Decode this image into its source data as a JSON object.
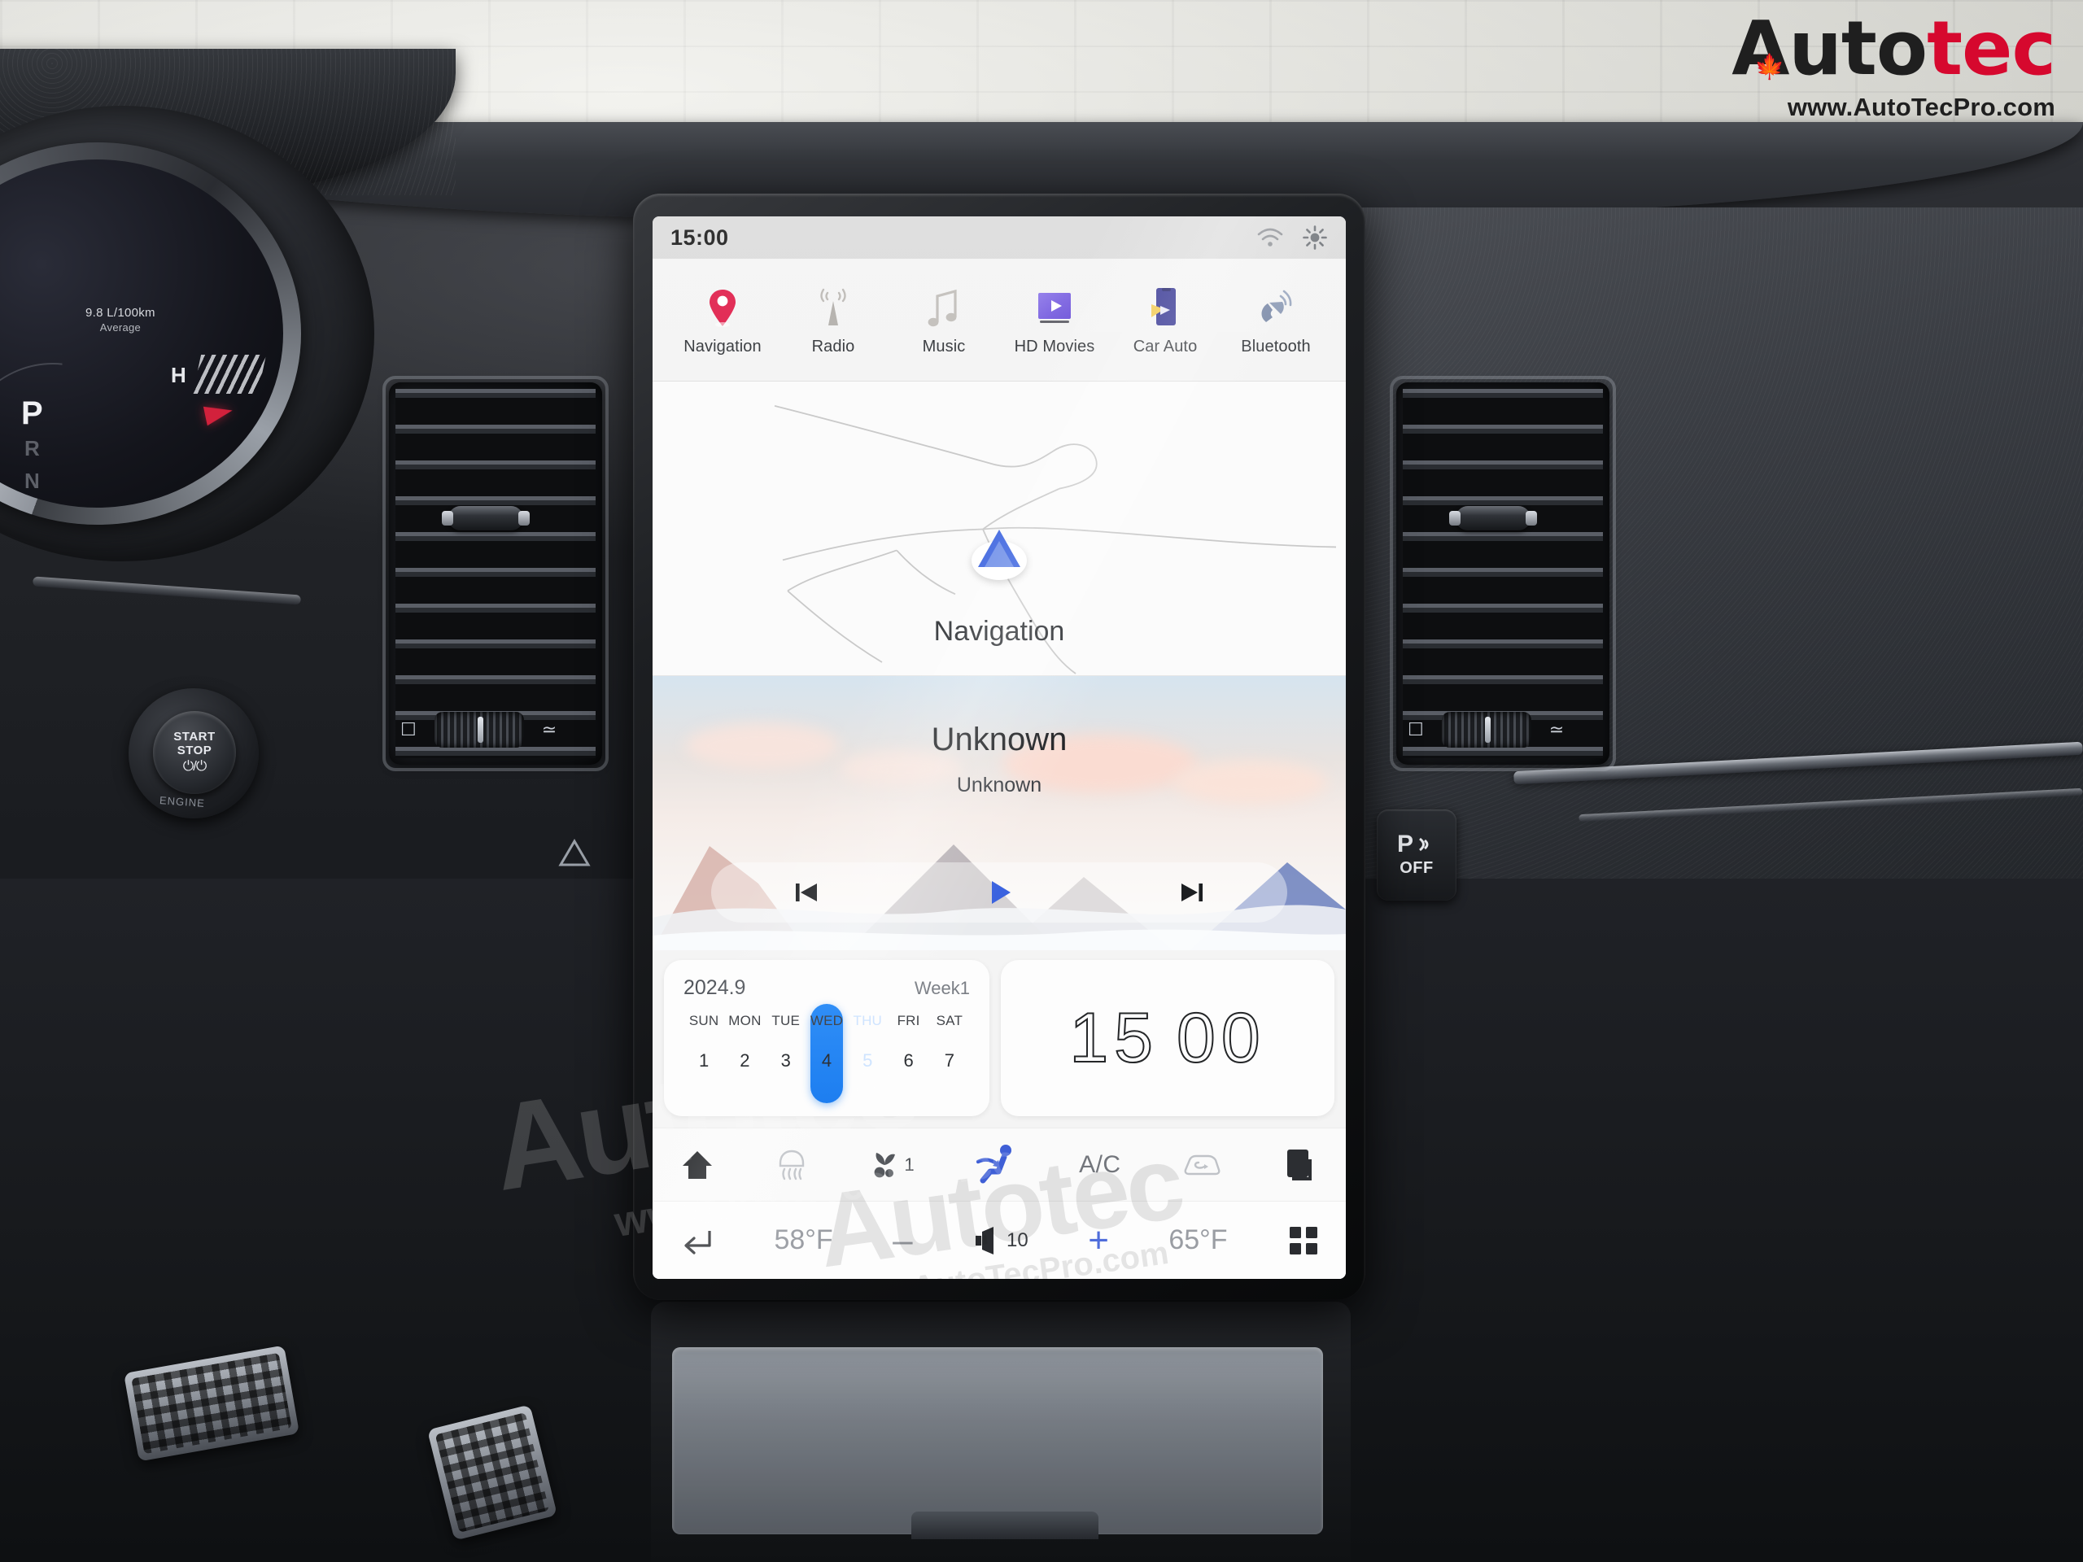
{
  "brand": {
    "name_part1": "Auto",
    "name_part2": "tec",
    "url": "www.AutoTecPro.com",
    "leaf_icon": "maple-leaf-icon",
    "color_black": "#1f1f1f",
    "color_red": "#d6082e"
  },
  "watermark": {
    "big": "Autotec",
    "small": "www.AutoTecPro.com"
  },
  "cluster": {
    "consumption": "9.8 L/100km",
    "consumption_label": "Average",
    "temp_label": "H",
    "gear_active": "P",
    "gear_2": "R",
    "gear_3": "N"
  },
  "controls": {
    "start_stop_line1": "START",
    "start_stop_line2": "STOP",
    "start_stop_symbol": "⏻/⏻",
    "engine_label": "ENGINE",
    "park_assist_p": "P",
    "park_assist_off": "OFF"
  },
  "screen": {
    "statusbar": {
      "time": "15:00",
      "wifi_icon": "wifi-icon",
      "brightness_icon": "brightness-sun-icon"
    },
    "apps": [
      {
        "label": "Navigation",
        "icon": "map-pin-icon",
        "color": "#e0234e"
      },
      {
        "label": "Radio",
        "icon": "radio-antenna-icon",
        "color": "#b3b0ac"
      },
      {
        "label": "Music",
        "icon": "music-note-icon",
        "color": "#c2bfbb"
      },
      {
        "label": "HD Movies",
        "icon": "video-play-icon",
        "color": "#7b62e0"
      },
      {
        "label": "Car Auto",
        "icon": "car-auto-phone-icon",
        "color": "#2f2f8f"
      },
      {
        "label": "Bluetooth",
        "icon": "phone-handset-icon",
        "color": "#7b8aa8"
      }
    ],
    "navigation_card": {
      "title": "Navigation",
      "position_marker_icon": "navigation-arrow-icon",
      "marker_color": "#3b63df"
    },
    "music_card": {
      "track_title": "Unknown",
      "track_artist": "Unknown",
      "prev_icon": "skip-previous-icon",
      "play_icon": "play-icon",
      "next_icon": "skip-next-icon",
      "play_color": "#3b63df"
    },
    "calendar_widget": {
      "year_month": "2024.9",
      "week": "Week1",
      "days": [
        "SUN",
        "MON",
        "TUE",
        "WED",
        "THU",
        "FRI",
        "SAT"
      ],
      "dates": [
        "1",
        "2",
        "3",
        "4",
        "5",
        "6",
        "7"
      ],
      "selected_index": 4,
      "selected_color": "#2f8ef7"
    },
    "clock_widget": {
      "hours": "15",
      "minutes": "00"
    },
    "climate_row": [
      {
        "name": "home-icon",
        "label": "",
        "active": false
      },
      {
        "name": "front-defrost-icon",
        "label": "",
        "active": false
      },
      {
        "name": "fan-speed-icon",
        "label": "1",
        "active": false
      },
      {
        "name": "seat-airflow-icon",
        "label": "",
        "active": true
      },
      {
        "name": "ac-icon",
        "label": "A/C",
        "active": false
      },
      {
        "name": "air-recirculation-icon",
        "label": "",
        "active": false
      },
      {
        "name": "rear-defrost-icon",
        "label": "",
        "active": false
      }
    ],
    "bottom_bar": {
      "back_icon": "back-arrow-icon",
      "driver_temp": "58°F",
      "minus_label": "–",
      "volume_icon": "volume-icon",
      "volume_level": "10",
      "plus_label": "+",
      "passenger_temp": "65°F",
      "apps_grid_icon": "apps-grid-icon",
      "plus_color": "#4f6ddb"
    }
  }
}
